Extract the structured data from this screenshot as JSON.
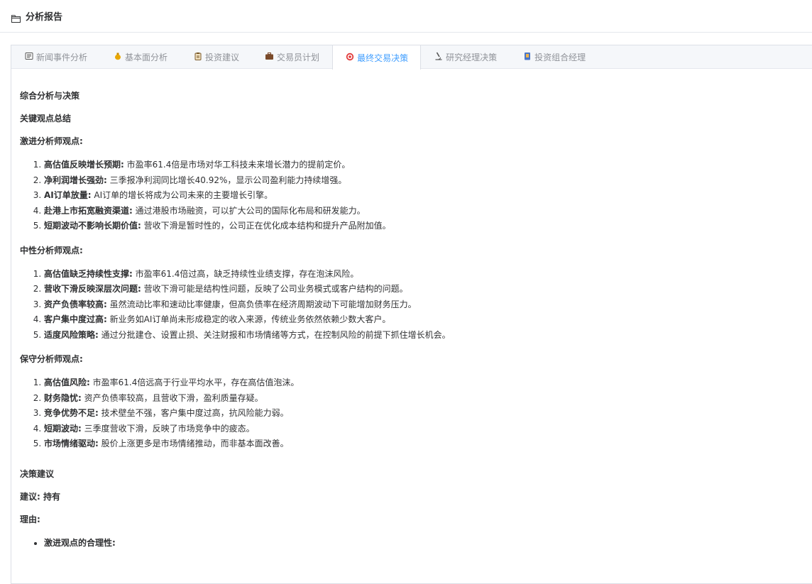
{
  "header": {
    "icon": "folder-icon",
    "title": "分析报告"
  },
  "tabs": [
    {
      "icon": "newspaper-icon",
      "label": "新闻事件分析",
      "active": false
    },
    {
      "icon": "money-bag-icon",
      "label": "基本面分析",
      "active": false
    },
    {
      "icon": "clipboard-icon",
      "label": "投资建议",
      "active": false
    },
    {
      "icon": "briefcase-icon",
      "label": "交易员计划",
      "active": false
    },
    {
      "icon": "target-icon",
      "label": "最终交易决策",
      "active": true
    },
    {
      "icon": "microscope-icon",
      "label": "研究经理决策",
      "active": false
    },
    {
      "icon": "portfolio-icon",
      "label": "投资组合经理",
      "active": false
    }
  ],
  "colors": {
    "accent": "#409eff",
    "tab_inactive": "#909399",
    "text": "#303133"
  },
  "report": {
    "h_main": "综合分析与决策",
    "h_summary": "关键观点总结",
    "aggressive": {
      "heading": "激进分析师观点:",
      "items": [
        {
          "bold": "高估值反映增长预期:",
          "text": " 市盈率61.4倍是市场对华工科技未来增长潜力的提前定价。"
        },
        {
          "bold": "净利润增长强劲:",
          "text": " 三季报净利润同比增长40.92%，显示公司盈利能力持续增强。"
        },
        {
          "bold": "AI订单放量:",
          "text": " AI订单的增长将成为公司未来的主要增长引擎。"
        },
        {
          "bold": "赴港上市拓宽融资渠道:",
          "text": " 通过港股市场融资，可以扩大公司的国际化布局和研发能力。"
        },
        {
          "bold": "短期波动不影响长期价值:",
          "text": " 营收下滑是暂时性的，公司正在优化成本结构和提升产品附加值。"
        }
      ]
    },
    "neutral": {
      "heading": "中性分析师观点:",
      "items": [
        {
          "bold": "高估值缺乏持续性支撑:",
          "text": " 市盈率61.4倍过高，缺乏持续性业绩支撑，存在泡沫风险。"
        },
        {
          "bold": "营收下滑反映深层次问题:",
          "text": " 营收下滑可能是结构性问题，反映了公司业务模式或客户结构的问题。"
        },
        {
          "bold": "资产负债率较高:",
          "text": " 虽然流动比率和速动比率健康，但高负债率在经济周期波动下可能增加财务压力。"
        },
        {
          "bold": "客户集中度过高:",
          "text": " 新业务如AI订单尚未形成稳定的收入来源，传统业务依然依赖少数大客户。"
        },
        {
          "bold": "适度风险策略:",
          "text": " 通过分批建仓、设置止损、关注财报和市场情绪等方式，在控制风险的前提下抓住增长机会。"
        }
      ]
    },
    "conservative": {
      "heading": "保守分析师观点:",
      "items": [
        {
          "bold": "高估值风险:",
          "text": " 市盈率61.4倍远高于行业平均水平，存在高估值泡沫。"
        },
        {
          "bold": "财务隐忧:",
          "text": " 资产负债率较高，且营收下滑，盈利质量存疑。"
        },
        {
          "bold": "竞争优势不足:",
          "text": " 技术壁垒不强，客户集中度过高，抗风险能力弱。"
        },
        {
          "bold": "短期波动:",
          "text": " 三季度营收下滑，反映了市场竞争中的疲态。"
        },
        {
          "bold": "市场情绪驱动:",
          "text": " 股价上涨更多是市场情绪推动，而非基本面改善。"
        }
      ]
    },
    "h_decision": "决策建议",
    "recommendation": "建议: 持有",
    "reason_heading": "理由:",
    "reasons": [
      {
        "bold": "激进观点的合理性:",
        "text": ""
      }
    ]
  }
}
